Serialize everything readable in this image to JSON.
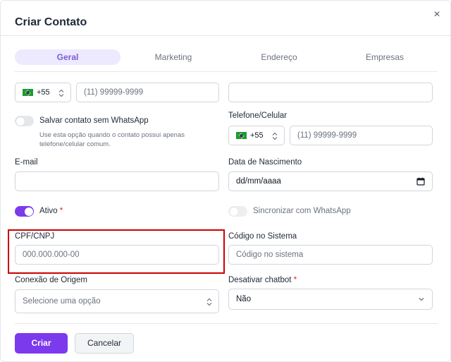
{
  "modal": {
    "title": "Criar Contato",
    "close_label": "×"
  },
  "tabs": [
    {
      "label": "Geral",
      "active": true
    },
    {
      "label": "Marketing",
      "active": false
    },
    {
      "label": "Endereço",
      "active": false
    },
    {
      "label": "Empresas",
      "active": false
    }
  ],
  "phone_main": {
    "country_code": "+55",
    "placeholder": "(11) 99999-9999"
  },
  "name_field": {
    "value": ""
  },
  "whatsapp_toggle": {
    "label": "Salvar contato sem WhatsApp",
    "hint": "Use esta opção quando o contato possui apenas telefone/celular comum.",
    "on": false
  },
  "phone_secondary": {
    "label": "Telefone/Celular",
    "country_code": "+55",
    "placeholder": "(11) 99999-9999"
  },
  "email": {
    "label": "E-mail",
    "value": ""
  },
  "birthdate": {
    "label": "Data de Nascimento",
    "placeholder": "dd/mm/aaaa"
  },
  "active_toggle": {
    "label": "Ativo",
    "required_mark": "*",
    "on": true
  },
  "sync_toggle": {
    "label": "Sincronizar com WhatsApp",
    "on": false
  },
  "cpf": {
    "label": "CPF/CNPJ",
    "placeholder": "000.000.000-00"
  },
  "system_code": {
    "label": "Código no Sistema",
    "placeholder": "Código no sistema"
  },
  "origin_connection": {
    "label": "Conexão de Origem",
    "placeholder": "Selecione uma opção"
  },
  "disable_chatbot": {
    "label": "Desativar chatbot",
    "required_mark": "*",
    "value": "Não"
  },
  "actions": {
    "create_label": "Criar",
    "cancel_label": "Cancelar"
  },
  "colors": {
    "accent": "#7c3aed",
    "highlight_box": "#cc0000"
  }
}
